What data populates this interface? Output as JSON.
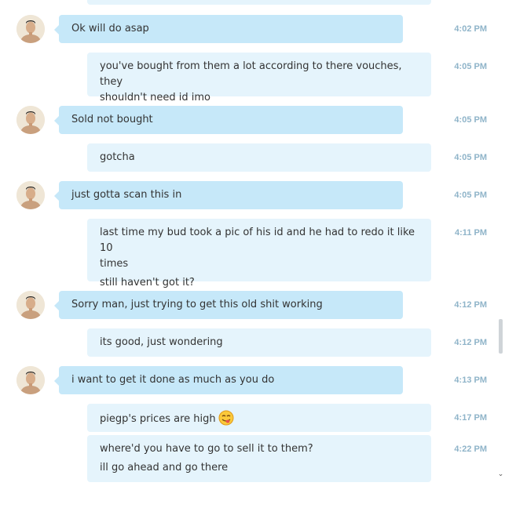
{
  "messages": [
    {
      "sender": "them",
      "lines": [
        "Ok will do asap"
      ],
      "time": "4:02 PM"
    },
    {
      "sender": "me",
      "lines": [
        "you've bought from them a lot according to there vouches, they",
        "shouldn't need id imo"
      ],
      "time": "4:05 PM"
    },
    {
      "sender": "them",
      "lines": [
        "Sold not bought"
      ],
      "time": "4:05 PM"
    },
    {
      "sender": "me",
      "lines": [
        "gotcha"
      ],
      "time": "4:05 PM"
    },
    {
      "sender": "them",
      "lines": [
        "just gotta scan this in"
      ],
      "time": "4:05 PM"
    },
    {
      "sender": "me",
      "lines": [
        "last time my bud took a pic of his id and he had to redo it like 10",
        "times",
        "still haven't got it?"
      ],
      "time": "4:11 PM"
    },
    {
      "sender": "them",
      "lines": [
        "Sorry man, just trying to get this old shit working"
      ],
      "time": "4:12 PM"
    },
    {
      "sender": "me",
      "lines": [
        "its good, just wondering"
      ],
      "time": "4:12 PM"
    },
    {
      "sender": "them",
      "lines": [
        "i want to get it done as much as you do"
      ],
      "time": "4:13 PM"
    },
    {
      "sender": "me",
      "lines": [
        "piegp's prices are high"
      ],
      "time": "4:17 PM",
      "emoji": "tongue-out-emoji"
    },
    {
      "sender": "me",
      "lines": [
        "where'd you have to go to sell it to them?",
        "ill go ahead and go there"
      ],
      "time": "4:22 PM"
    }
  ],
  "colors": {
    "incoming_bubble": "#c6e8f9",
    "outgoing_bubble": "#e5f4fc",
    "timestamp": "#8fb4c9"
  }
}
